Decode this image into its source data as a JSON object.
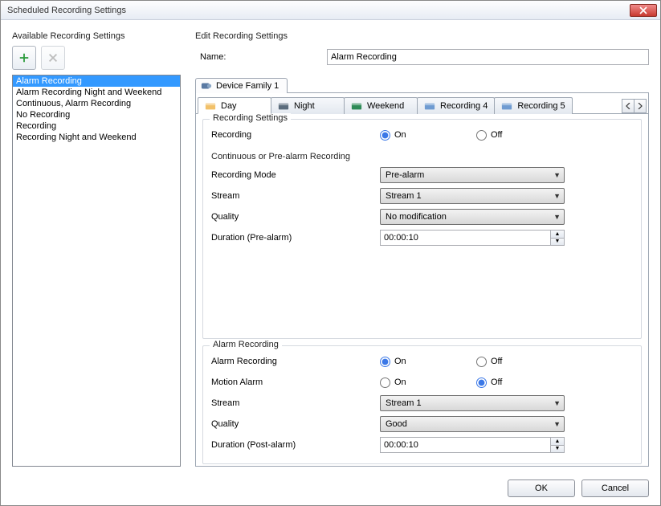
{
  "window": {
    "title": "Scheduled Recording Settings"
  },
  "left": {
    "title": "Available Recording Settings",
    "items": [
      "Alarm Recording",
      "Alarm Recording Night and Weekend",
      "Continuous, Alarm Recording",
      "No Recording",
      "Recording",
      "Recording Night and Weekend"
    ],
    "selected_index": 0
  },
  "edit": {
    "title": "Edit Recording Settings",
    "name_label": "Name:",
    "name_value": "Alarm Recording",
    "device_tab": "Device Family 1",
    "sub_tabs": [
      "Day",
      "Night",
      "Weekend",
      "Recording 4",
      "Recording 5"
    ],
    "active_sub_tab": 0,
    "tab_colors": [
      "#f2c16a",
      "#5a6b7c",
      "#2e8b57",
      "#6f9bd1",
      "#6f9bd1"
    ],
    "fields": {
      "recording_settings_legend": "Recording Settings",
      "recording_label": "Recording",
      "on": "On",
      "off": "Off",
      "recording_value": "On",
      "cont_pre_label": "Continuous or Pre-alarm Recording",
      "recording_mode_label": "Recording Mode",
      "recording_mode_value": "Pre-alarm",
      "stream_label": "Stream",
      "stream_value": "Stream 1",
      "quality_label": "Quality",
      "quality_value": "No modification",
      "duration_pre_label": "Duration (Pre-alarm)",
      "duration_pre_value": "00:00:10",
      "alarm_recording_legend": "Alarm Recording",
      "alarm_recording_label": "Alarm Recording",
      "alarm_recording_value": "On",
      "motion_alarm_label": "Motion Alarm",
      "motion_alarm_value": "Off",
      "alarm_stream_label": "Stream",
      "alarm_stream_value": "Stream 1",
      "alarm_quality_label": "Quality",
      "alarm_quality_value": "Good",
      "duration_post_label": "Duration (Post-alarm)",
      "duration_post_value": "00:00:10"
    }
  },
  "buttons": {
    "ok": "OK",
    "cancel": "Cancel"
  }
}
